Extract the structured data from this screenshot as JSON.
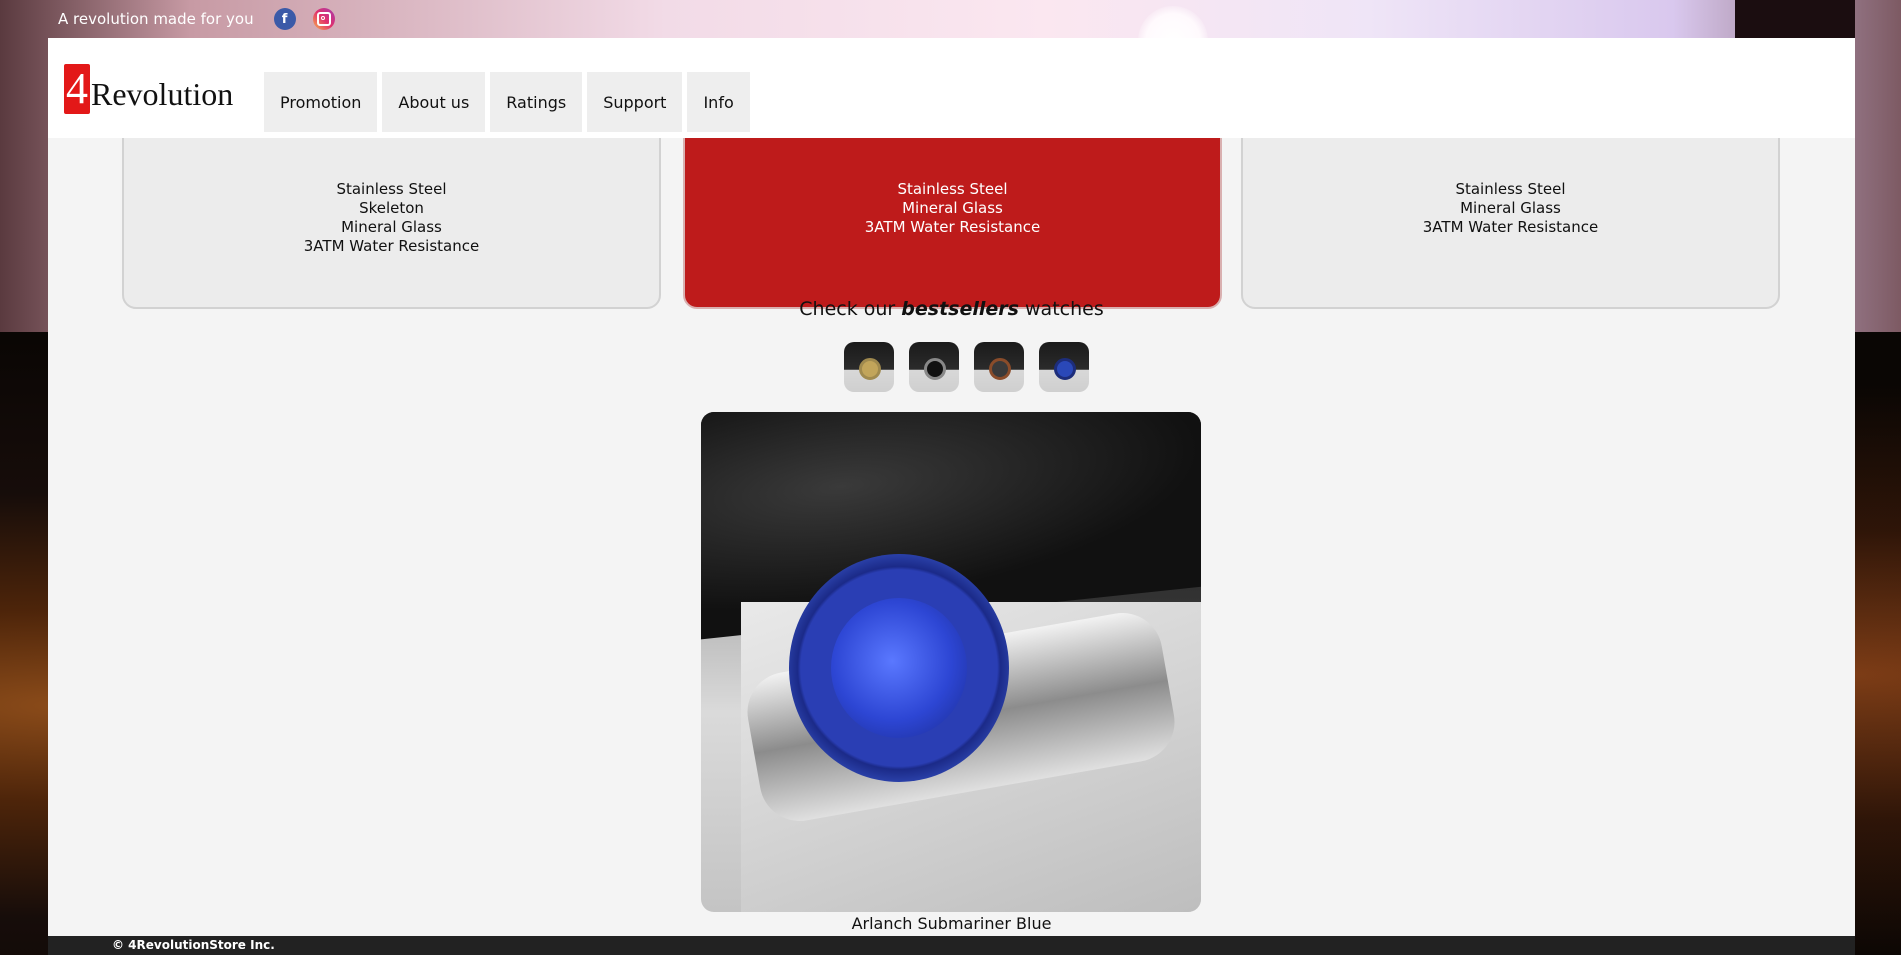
{
  "topbar": {
    "tagline": "A revolution made for you",
    "social": [
      {
        "name": "facebook-icon",
        "glyph": "f"
      },
      {
        "name": "instagram-icon"
      }
    ]
  },
  "header": {
    "logo": {
      "digit": "4",
      "word": "Revolution"
    },
    "nav": [
      "Promotion",
      "About us",
      "Ratings",
      "Support",
      "Info"
    ]
  },
  "cards": [
    {
      "features": [
        "Stainless Steel",
        "Skeleton",
        "Mineral Glass",
        "3ATM Water Resistance"
      ],
      "highlight": false
    },
    {
      "features": [
        "Stainless Steel",
        "Mineral Glass",
        "3ATM Water Resistance"
      ],
      "highlight": true
    },
    {
      "features": [
        "Stainless Steel",
        "Mineral Glass",
        "3ATM Water Resistance"
      ],
      "highlight": false
    }
  ],
  "bestsellers": {
    "prefix": "Check our ",
    "emphasis": "bestsellers",
    "suffix": " watches",
    "thumbnails": [
      "gold-watch",
      "black-watch",
      "brown-strap-watch",
      "blue-watch"
    ],
    "selected": 3
  },
  "hero": {
    "caption": "Arlanch Submariner Blue"
  },
  "footer": {
    "copyright": "© 4RevolutionStore Inc."
  },
  "colors": {
    "accent": "#be1b1b",
    "logo_red": "#e31818",
    "footer": "#222222"
  }
}
